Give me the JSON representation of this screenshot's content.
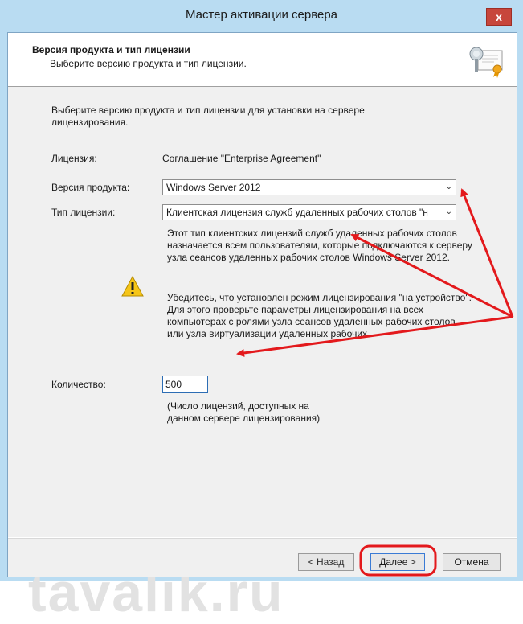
{
  "window": {
    "title": "Мастер активации сервера",
    "close_symbol": "x"
  },
  "header": {
    "title": "Версия продукта и тип лицензии",
    "subtitle": "Выберите версию продукта и тип лицензии.",
    "icon": "certificate-icon"
  },
  "body": {
    "intro": "Выберите версию продукта и тип лицензии для установки на сервере лицензирования.",
    "license_label": "Лицензия:",
    "license_value": "Соглашение \"Enterprise Agreement\"",
    "product_version_label": "Версия продукта:",
    "product_version_value": "Windows Server 2012",
    "license_type_label": "Тип лицензии:",
    "license_type_value": "Клиентская лицензия служб удаленных рабочих столов \"н",
    "note1": "Этот тип клиентских лицензий служб удаленных рабочих столов назначается всем пользователям, которые подключаются к серверу узла сеансов удаленных рабочих столов Windows Server 2012.",
    "note2": "Убедитесь, что установлен режим лицензирования \"на устройство\". Для этого проверьте параметры лицензирования на всех компьютерах с ролями узла сеансов удаленных рабочих столов или узла виртуализации удаленных рабочих",
    "warning_icon": "warning-icon",
    "quantity_label": "Количество:",
    "quantity_value": "500",
    "quantity_hint": "(Число лицензий, доступных на данном сервере лицензирования)"
  },
  "watermark": "tavalik.ru",
  "footer": {
    "back_label": "< Назад",
    "next_label": "Далее >",
    "cancel_label": "Отмена"
  },
  "colors": {
    "title_bar": "#b9dcf2",
    "close_button": "#c7463b",
    "annotation": "#e3191c",
    "page_background": "#f0f0f0"
  }
}
